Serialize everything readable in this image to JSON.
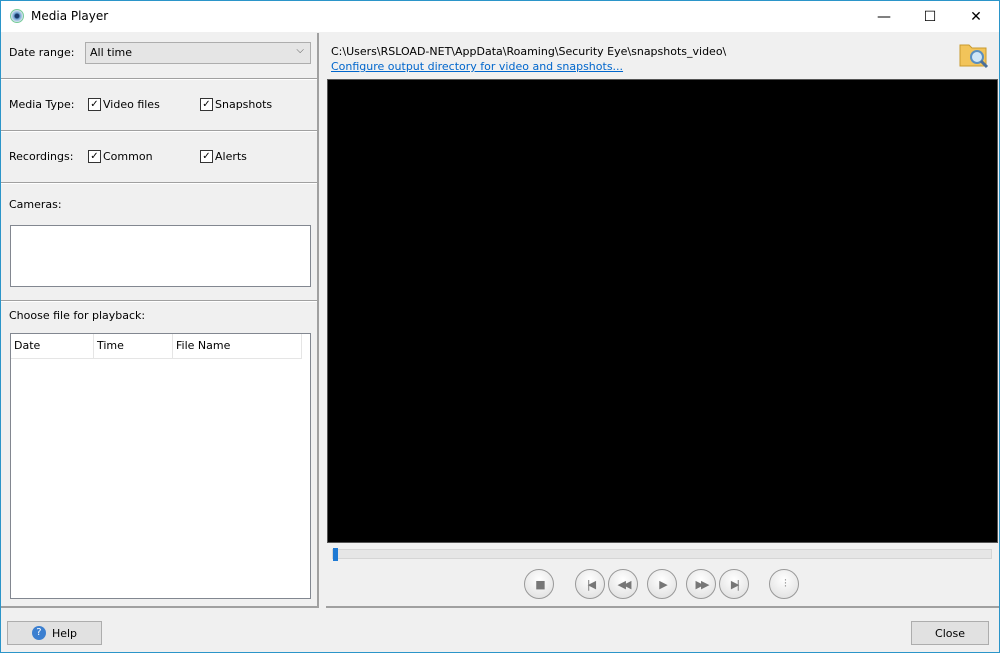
{
  "window": {
    "title": "Media Player",
    "minimize": "—",
    "maximize": "☐",
    "close": "✕"
  },
  "filters": {
    "date_range_label": "Date range:",
    "date_range_value": "All time",
    "media_type_label": "Media Type:",
    "video_files": "Video files",
    "snapshots": "Snapshots",
    "recordings_label": "Recordings:",
    "common": "Common",
    "alerts": "Alerts",
    "cameras_label": "Cameras:",
    "choose_file_label": "Choose file for playback:"
  },
  "file_table": {
    "columns": [
      "Date",
      "Time",
      "File Name"
    ],
    "rows": []
  },
  "output": {
    "path": "C:\\Users\\RSLOAD-NET\\AppData\\Roaming\\Security Eye\\snapshots_video\\",
    "configure_link": "Configure output directory for video and snapshots..."
  },
  "playback": {
    "progress": 0
  },
  "controls": {
    "stop": "■",
    "first": "|◀",
    "rewind": "◀◀",
    "play": "▶",
    "forward": "▶▶",
    "last": "▶|",
    "settings": "⫶"
  },
  "footer": {
    "help": "Help",
    "close": "Close"
  }
}
